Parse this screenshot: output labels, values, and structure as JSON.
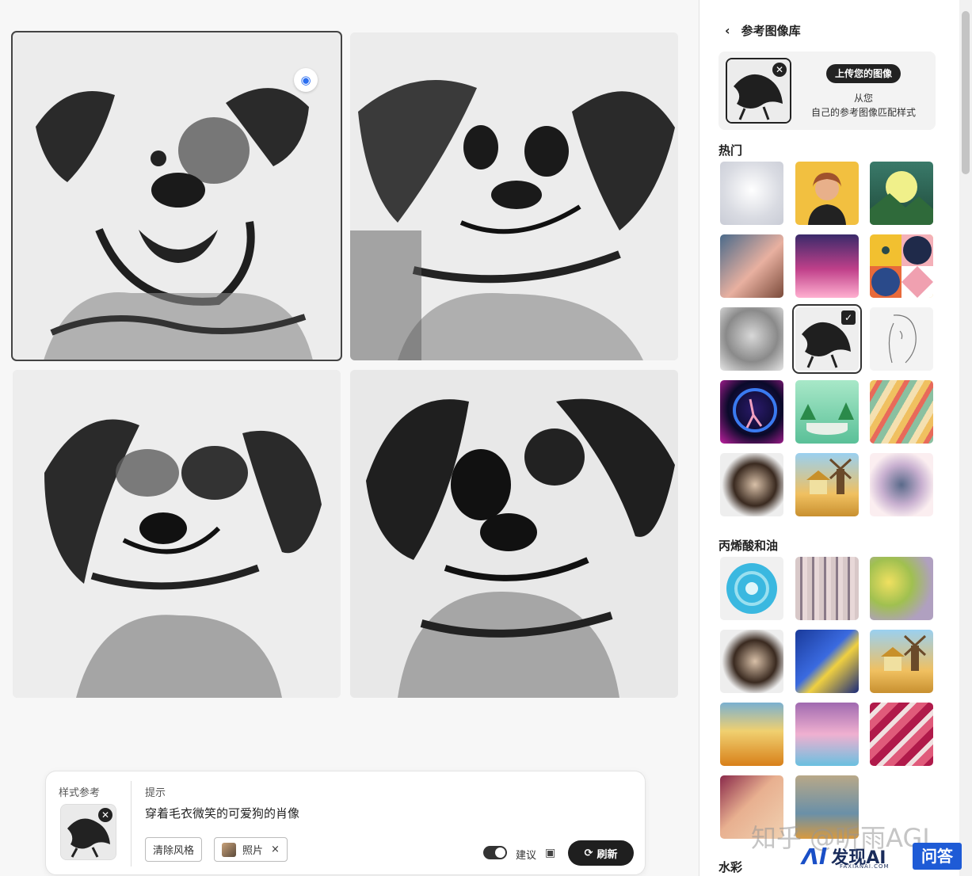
{
  "gallery_tiles": [
    {
      "name": "result-1",
      "selected": true
    },
    {
      "name": "result-2",
      "selected": false
    },
    {
      "name": "result-3",
      "selected": false
    },
    {
      "name": "result-4",
      "selected": false
    }
  ],
  "tile_icon": "scan-target-icon",
  "prompt_panel": {
    "style_ref_label": "样式参考",
    "prompt_label": "提示",
    "prompt_text": "穿着毛衣微笑的可爱狗的肖像",
    "clear_style_label": "清除风格",
    "photo_chip_label": "照片",
    "photo_chip_close": "×",
    "suggest_label": "建议",
    "refresh_label": "刷新"
  },
  "side_panel": {
    "title": "参考图像库",
    "upload_button": "上传您的图像",
    "upload_desc_line1": "从您",
    "upload_desc_line2": "自己的参考图像匹配样式",
    "sections": [
      {
        "title": "热门",
        "count": 15,
        "selected_index": 7
      },
      {
        "title": "丙烯酸和油",
        "count": 11
      },
      {
        "title": "水彩",
        "count": 0
      }
    ]
  },
  "watermark": {
    "zhihu": "知乎 @听雨AGI",
    "brand": "发现AI",
    "brand_sub": "FAXIANAI.COM",
    "qa": "问答"
  },
  "colors": {
    "accent_dark": "#1f1f1f",
    "scan_icon_blue": "#2a6ef0",
    "watermark_blue": "#1e5bd6"
  }
}
